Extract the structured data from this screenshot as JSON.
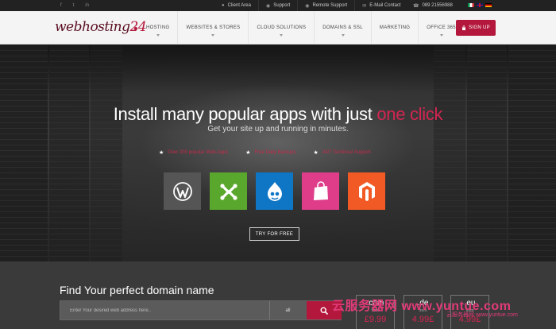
{
  "topbar": {
    "social": [
      "f",
      "t",
      "in"
    ],
    "links": [
      {
        "icon": "user-icon",
        "label": "Client Area"
      },
      {
        "icon": "support-icon",
        "label": "Support"
      },
      {
        "icon": "remote-icon",
        "label": "Remote Support"
      },
      {
        "icon": "mail-icon",
        "label": "E-Mail Contact"
      }
    ],
    "phone": "089 21556988"
  },
  "nav": {
    "logo_text": "webhosting",
    "logo_num": "24",
    "items": [
      "HOSTING",
      "WEBSITES & STORES",
      "CLOUD SOLUTIONS",
      "DOMAINS & SSL",
      "MARKETING",
      "OFFICE 365"
    ],
    "signup": "SIGN UP"
  },
  "hero": {
    "headline_main": "Install many popular apps with just",
    "headline_accent": "one click",
    "subline": "Get your site up and running in minutes.",
    "features": [
      "Over 200 popular Web-Apps",
      "Free Daily Backups",
      "24/7 Technical Support"
    ],
    "apps": [
      "wordpress-icon",
      "joomla-icon",
      "drupal-icon",
      "prestashop-icon",
      "magento-icon"
    ],
    "cta": "TRY FOR FREE"
  },
  "domain": {
    "title": "Find Your perfect domain name",
    "placeholder": "Enter Your desired web address here..",
    "select": "all",
    "tlds": [
      {
        "ext": ".com",
        "from": "from",
        "price": "£9.99"
      },
      {
        "ext": ".de",
        "from": "from",
        "price": "4.99£"
      },
      {
        "ext": ".eu",
        "from": "from",
        "price": "4.99£"
      }
    ]
  },
  "watermark": {
    "main": "云服务器网 www.yuntue.com",
    "sub": "云服务器网 www.yuntue.com"
  },
  "colors": {
    "accent": "#b3183c",
    "dark": "#222222"
  }
}
